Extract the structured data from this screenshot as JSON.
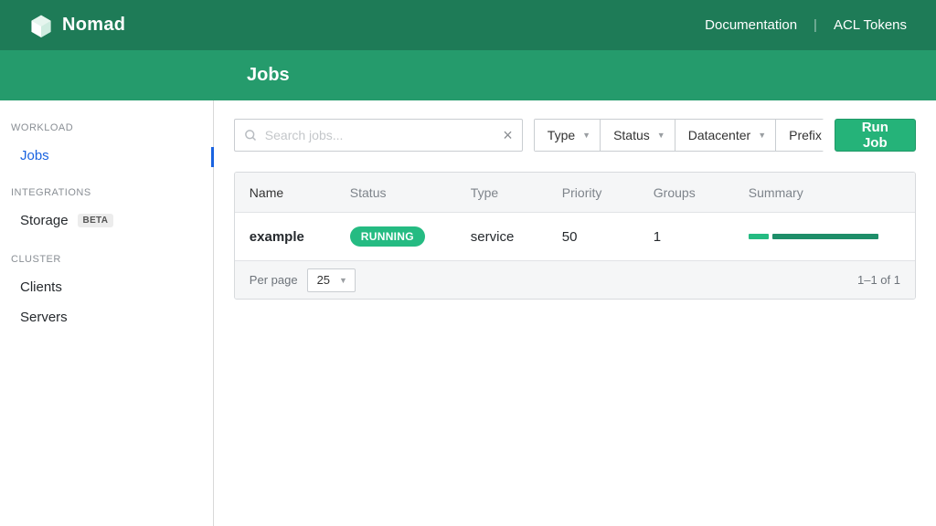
{
  "brand": {
    "name": "Nomad"
  },
  "topnav": {
    "documentation": "Documentation",
    "acl": "ACL Tokens"
  },
  "page_title": "Jobs",
  "sidebar": {
    "groups": [
      {
        "label": "WORKLOAD",
        "items": [
          {
            "label": "Jobs",
            "active": true
          }
        ]
      },
      {
        "label": "INTEGRATIONS",
        "items": [
          {
            "label": "Storage",
            "badge": "BETA"
          }
        ]
      },
      {
        "label": "CLUSTER",
        "items": [
          {
            "label": "Clients"
          },
          {
            "label": "Servers"
          }
        ]
      }
    ]
  },
  "toolbar": {
    "search_placeholder": "Search jobs...",
    "filters": {
      "type": "Type",
      "status": "Status",
      "datacenter": "Datacenter",
      "prefix": "Prefix"
    },
    "run_job": "Run Job"
  },
  "table": {
    "headers": {
      "name": "Name",
      "status": "Status",
      "type": "Type",
      "priority": "Priority",
      "groups": "Groups",
      "summary": "Summary"
    },
    "rows": [
      {
        "name": "example",
        "status": "RUNNING",
        "type": "service",
        "priority": "50",
        "groups": "1"
      }
    ],
    "footer": {
      "per_page_label": "Per page",
      "per_page_value": "25",
      "range": "1–1 of 1"
    }
  },
  "colors": {
    "brand_green_dark": "#1e7b57",
    "brand_green": "#259b6c",
    "accent": "#25bb82",
    "link_blue": "#1a63e0"
  }
}
